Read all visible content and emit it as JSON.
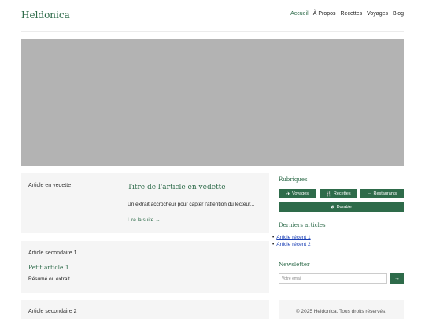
{
  "header": {
    "logo": "Heldonica",
    "nav": [
      "Accueil",
      "À Propos",
      "Recettes",
      "Voyages",
      "Blog"
    ]
  },
  "featured": {
    "image_alt": "Article en vedette",
    "title": "Titre de l'article en vedette",
    "excerpt": "Un extrait accrocheur pour capter l'attention du lecteur...",
    "read_more": "Lire la suite →"
  },
  "secondary": [
    {
      "image_alt": "Article secondaire 1",
      "title": "Petit article 1",
      "excerpt": "Résumé ou extrait..."
    },
    {
      "image_alt": "Article secondaire 2"
    }
  ],
  "sidebar": {
    "categories_title": "Rubriques",
    "categories": [
      {
        "label": "Voyages",
        "icon": "plane-icon"
      },
      {
        "label": "Recettes",
        "icon": "utensils-icon"
      },
      {
        "label": "Restaurants",
        "icon": "store-icon"
      },
      {
        "label": "Durable",
        "icon": "leaf-icon"
      }
    ],
    "recent_title": "Derniers articles",
    "recent": [
      "Article récent 1",
      "Article récent 2"
    ],
    "newsletter_title": "Newsletter",
    "email_placeholder": "Votre email",
    "submit": "→"
  },
  "footer": "© 2025 Heldonica. Tous droits réservés.",
  "colors": {
    "accent": "#2e6b4a",
    "hero": "#b3b3b3",
    "card": "#f5f5f5",
    "link": "#1a3fb5"
  }
}
